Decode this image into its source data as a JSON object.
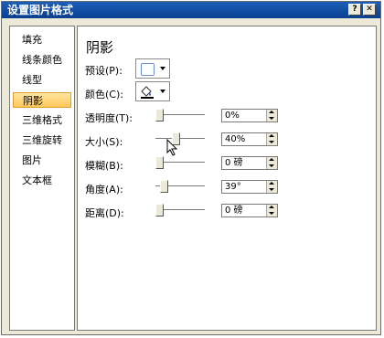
{
  "window": {
    "title": "设置图片格式",
    "help_label": "?",
    "close_label": "✕"
  },
  "sidebar": {
    "items": [
      {
        "label": "填充"
      },
      {
        "label": "线条颜色"
      },
      {
        "label": "线型"
      },
      {
        "label": "阴影",
        "active": true
      },
      {
        "label": "三维格式"
      },
      {
        "label": "三维旋转"
      },
      {
        "label": "图片"
      },
      {
        "label": "文本框"
      }
    ]
  },
  "panel": {
    "title": "阴影",
    "preset": {
      "label": "预设(P):"
    },
    "color": {
      "label": "颜色(C):"
    },
    "transparency": {
      "label": "透明度(T):",
      "value": "0%",
      "level": 0
    },
    "size": {
      "label": "大小(S):",
      "value": "40%",
      "level": 0.4
    },
    "blur": {
      "label": "模糊(B):",
      "value": "0 磅",
      "level": 0
    },
    "angle": {
      "label": "角度(A):",
      "value": "39°",
      "level": 0.1
    },
    "distance": {
      "label": "距离(D):",
      "value": "0 磅",
      "level": 0
    }
  },
  "colors": {
    "title_bar": "#0b3f8f",
    "active_item": "#ffc85a"
  },
  "icons": {
    "preset": "shadow-preset-icon",
    "color": "paint-bucket-icon",
    "cursor": "mouse-cursor-icon"
  }
}
